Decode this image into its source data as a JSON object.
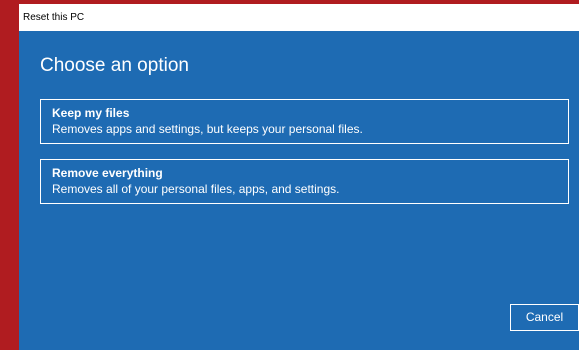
{
  "window": {
    "title": "Reset this PC"
  },
  "main": {
    "heading": "Choose an option",
    "options": [
      {
        "title": "Keep my files",
        "description": "Removes apps and settings, but keeps your personal files."
      },
      {
        "title": "Remove everything",
        "description": "Removes all of your personal files, apps, and settings."
      }
    ]
  },
  "footer": {
    "cancel_label": "Cancel"
  },
  "colors": {
    "background": "#b01c20",
    "dialog": "#1e6bb3",
    "text": "#ffffff"
  }
}
